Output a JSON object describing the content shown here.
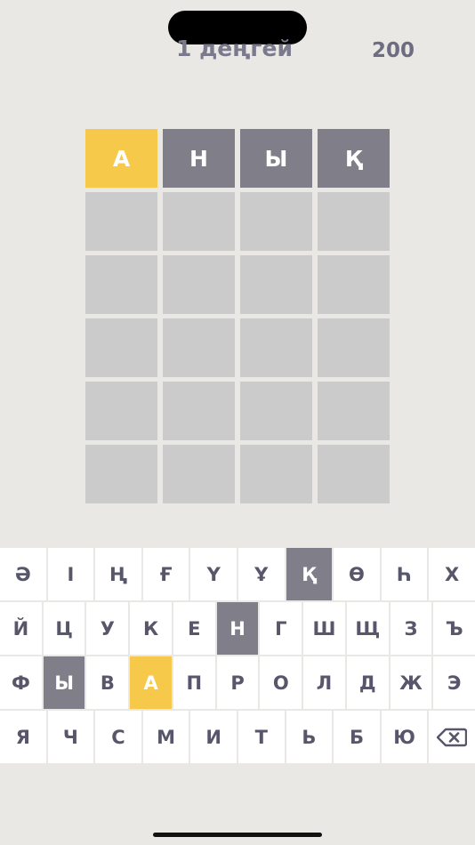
{
  "header": {
    "level_text": "1 деңгей",
    "score": "200"
  },
  "colors": {
    "present": "#f6c94a",
    "absent": "#7f7e89",
    "empty": "#cbcbcb",
    "background": "#e9e8e4"
  },
  "board": {
    "rows": [
      [
        {
          "letter": "А",
          "state": "present"
        },
        {
          "letter": "Н",
          "state": "absent"
        },
        {
          "letter": "Ы",
          "state": "absent"
        },
        {
          "letter": "Қ",
          "state": "absent"
        }
      ],
      [
        {
          "letter": "",
          "state": "empty"
        },
        {
          "letter": "",
          "state": "empty"
        },
        {
          "letter": "",
          "state": "empty"
        },
        {
          "letter": "",
          "state": "empty"
        }
      ],
      [
        {
          "letter": "",
          "state": "empty"
        },
        {
          "letter": "",
          "state": "empty"
        },
        {
          "letter": "",
          "state": "empty"
        },
        {
          "letter": "",
          "state": "empty"
        }
      ],
      [
        {
          "letter": "",
          "state": "empty"
        },
        {
          "letter": "",
          "state": "empty"
        },
        {
          "letter": "",
          "state": "empty"
        },
        {
          "letter": "",
          "state": "empty"
        }
      ],
      [
        {
          "letter": "",
          "state": "empty"
        },
        {
          "letter": "",
          "state": "empty"
        },
        {
          "letter": "",
          "state": "empty"
        },
        {
          "letter": "",
          "state": "empty"
        }
      ],
      [
        {
          "letter": "",
          "state": "empty"
        },
        {
          "letter": "",
          "state": "empty"
        },
        {
          "letter": "",
          "state": "empty"
        },
        {
          "letter": "",
          "state": "empty"
        }
      ]
    ]
  },
  "keyboard": {
    "rows": [
      [
        {
          "key": "Ә"
        },
        {
          "key": "І"
        },
        {
          "key": "Ң"
        },
        {
          "key": "Ғ"
        },
        {
          "key": "Ү"
        },
        {
          "key": "Ұ"
        },
        {
          "key": "Қ",
          "state": "absent"
        },
        {
          "key": "Ө"
        },
        {
          "key": "Һ"
        },
        {
          "key": "Х"
        }
      ],
      [
        {
          "key": "Й"
        },
        {
          "key": "Ц"
        },
        {
          "key": "У"
        },
        {
          "key": "К"
        },
        {
          "key": "Е"
        },
        {
          "key": "Н",
          "state": "absent"
        },
        {
          "key": "Г"
        },
        {
          "key": "Ш"
        },
        {
          "key": "Щ"
        },
        {
          "key": "З"
        },
        {
          "key": "Ъ"
        }
      ],
      [
        {
          "key": "Ф"
        },
        {
          "key": "Ы",
          "state": "absent"
        },
        {
          "key": "В"
        },
        {
          "key": "А",
          "state": "present"
        },
        {
          "key": "П"
        },
        {
          "key": "Р"
        },
        {
          "key": "О"
        },
        {
          "key": "Л"
        },
        {
          "key": "Д"
        },
        {
          "key": "Ж"
        },
        {
          "key": "Э"
        }
      ],
      [
        {
          "key": "Я"
        },
        {
          "key": "Ч"
        },
        {
          "key": "С"
        },
        {
          "key": "М"
        },
        {
          "key": "И"
        },
        {
          "key": "Т"
        },
        {
          "key": "Ь"
        },
        {
          "key": "Б"
        },
        {
          "key": "Ю"
        },
        {
          "key": "",
          "icon": "backspace-icon"
        }
      ]
    ]
  }
}
